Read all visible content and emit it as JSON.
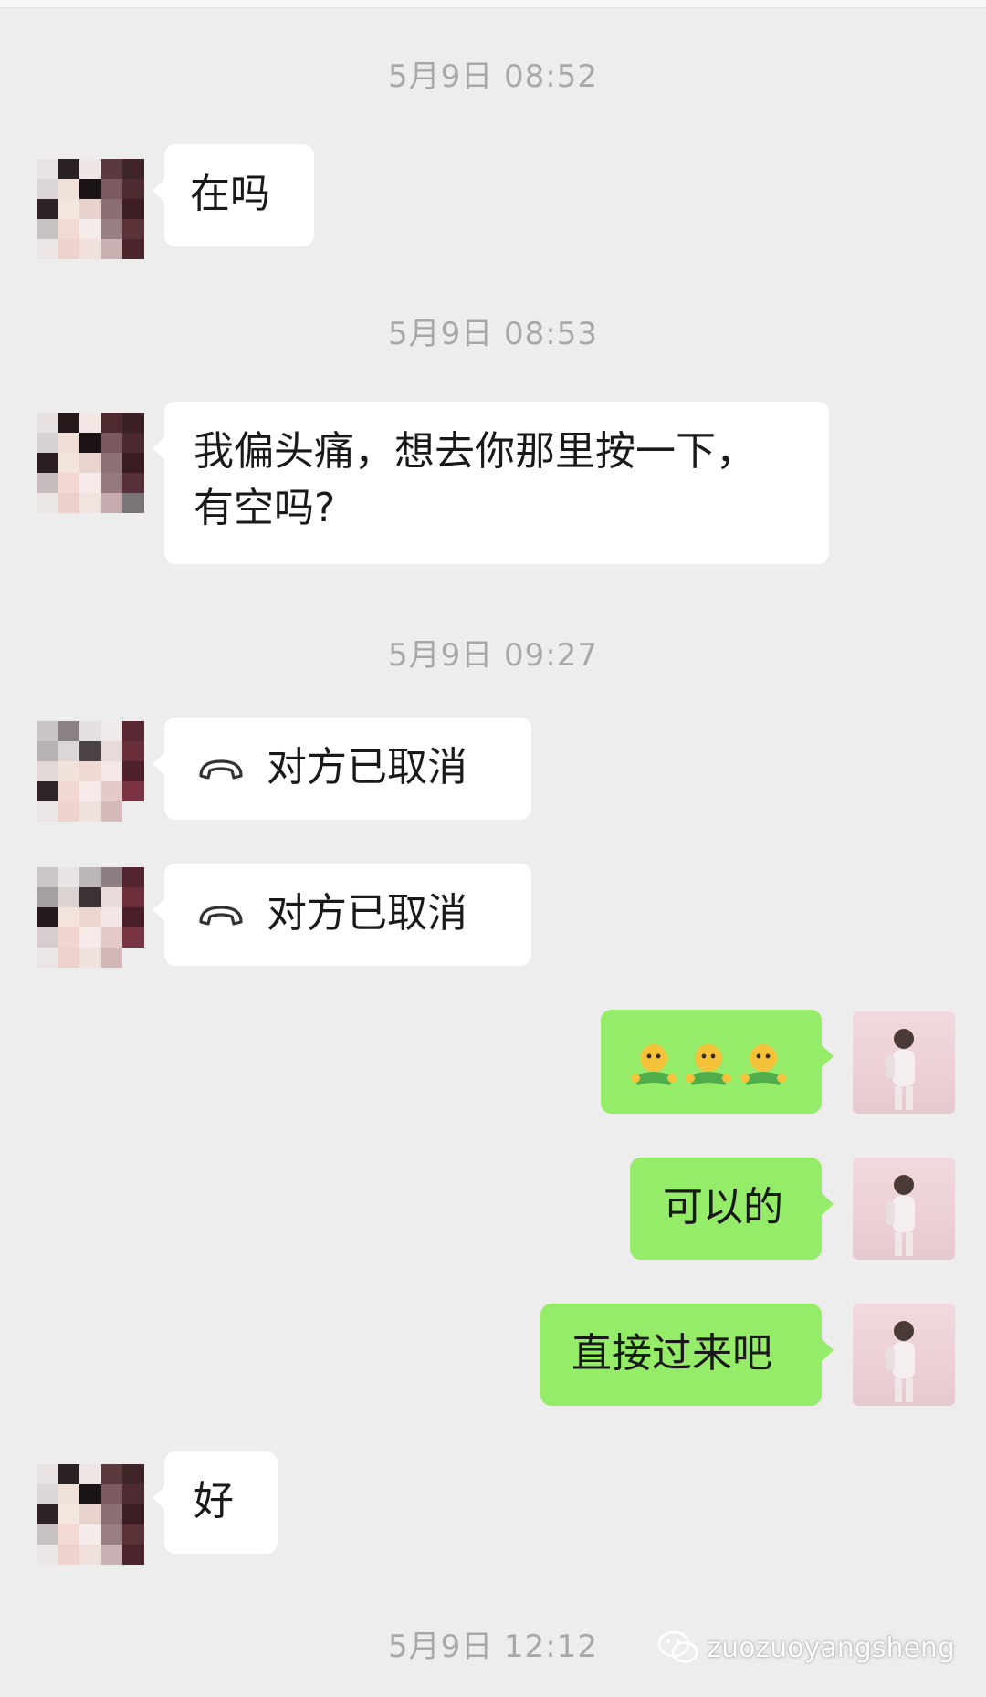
{
  "messages": {
    "ts1": "5月9日 08:52",
    "m1": "在吗",
    "ts2": "5月9日 08:53",
    "m2_line1": "我偏头痛，想去你那里按一下，",
    "m2_line2": "有空吗?",
    "ts3": "5月9日 09:27",
    "call1": "对方已取消",
    "call2": "对方已取消",
    "emoji_reply": "🤗🤗🤗",
    "r1": "可以的",
    "r2": "直接过来吧",
    "m3": "好",
    "ts4": "5月9日 12:12"
  },
  "watermark": {
    "text": "zuozuoyangsheng",
    "icon": "wechat-icon"
  },
  "colors": {
    "background": "#ededed",
    "incoming_bubble": "#ffffff",
    "outgoing_bubble": "#95ec69",
    "timestamp": "#a8a8a8"
  }
}
